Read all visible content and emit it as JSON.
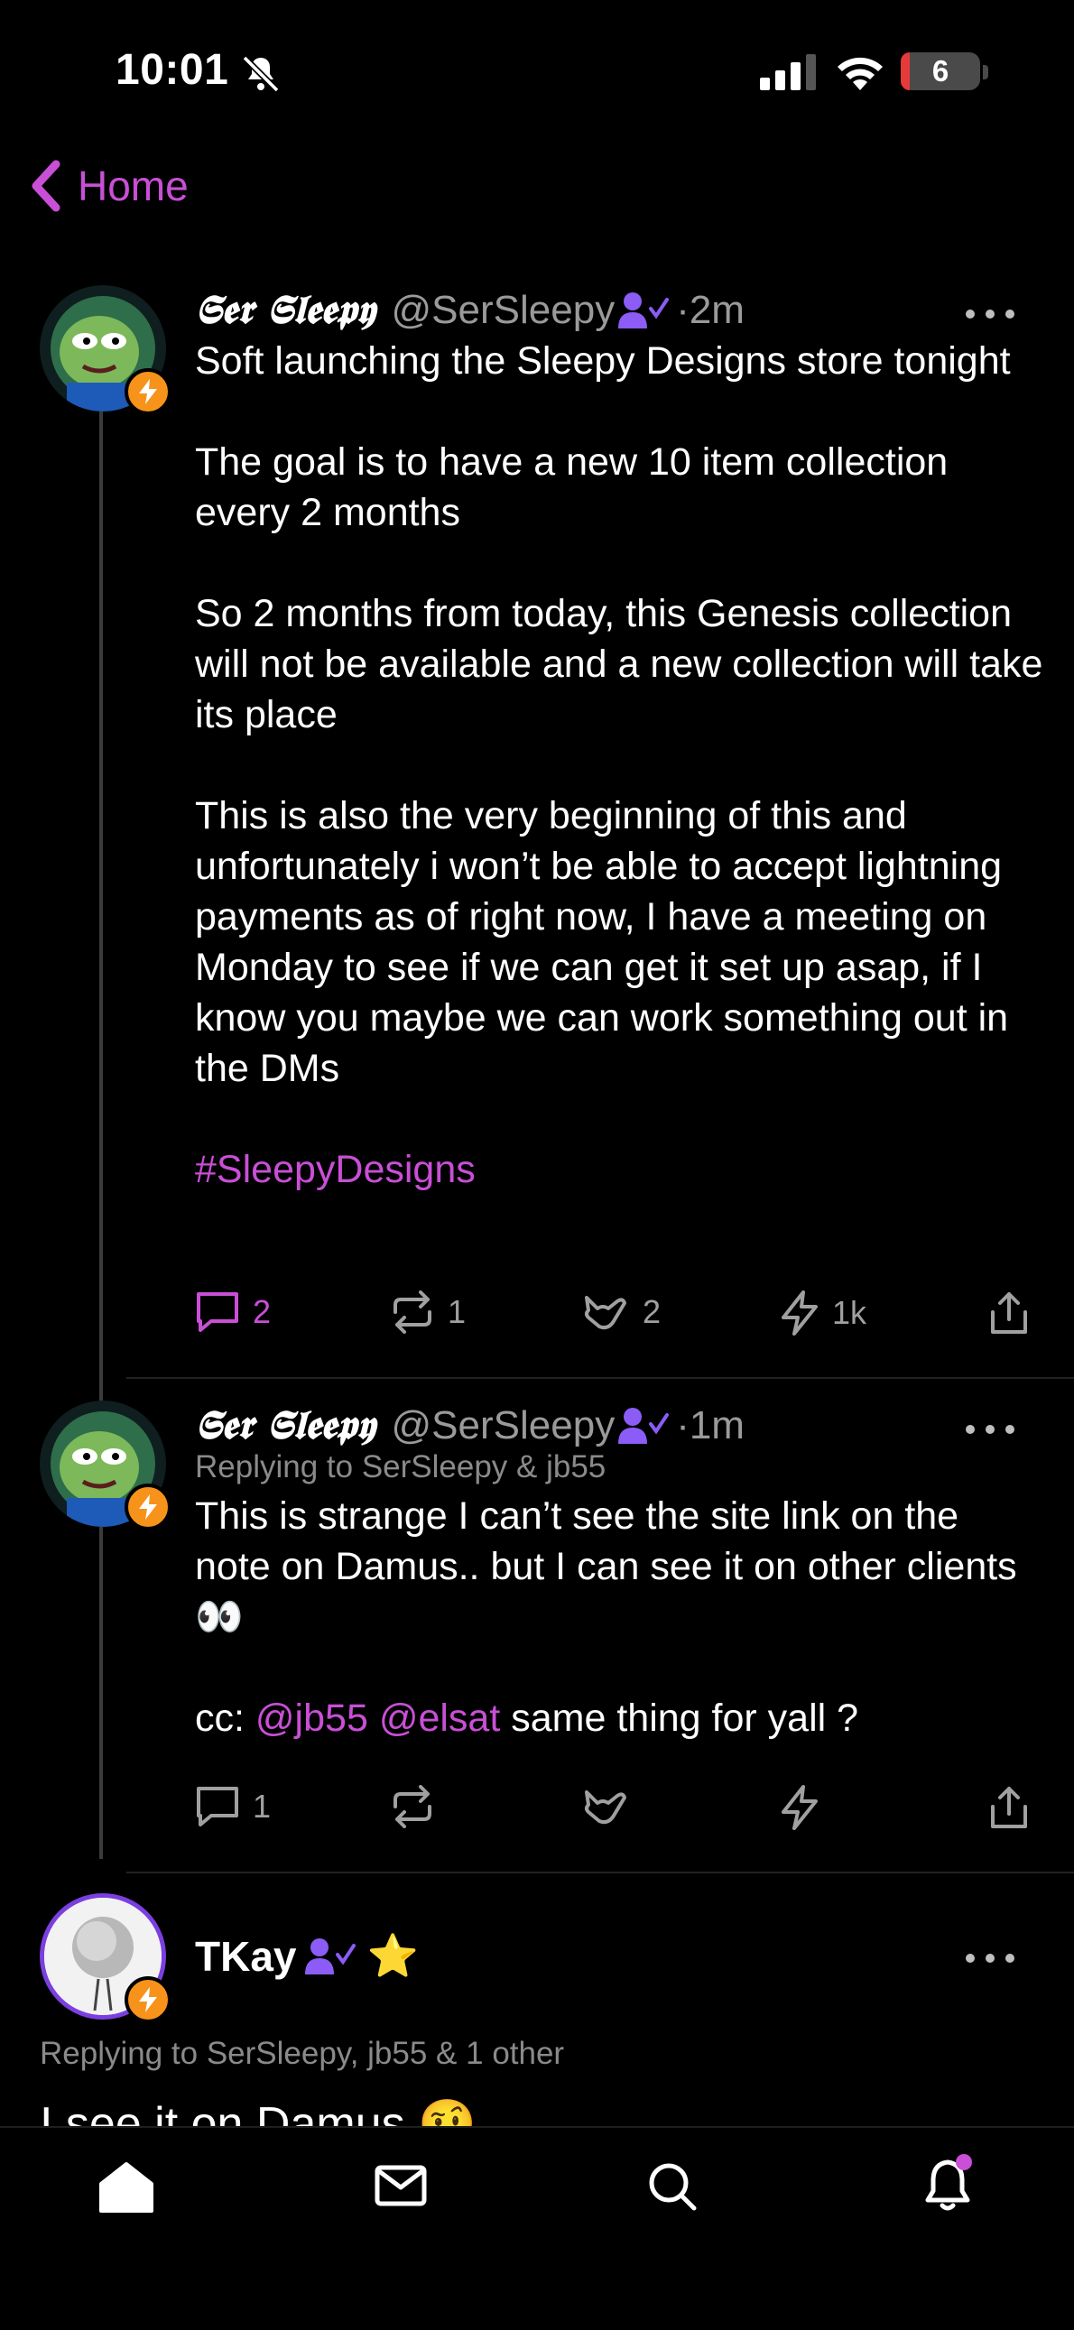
{
  "status_bar": {
    "time": "10:01",
    "battery": "6"
  },
  "header": {
    "back_label": "Home"
  },
  "posts": [
    {
      "display_name": "𝕾𝖊𝖗 𝕾𝖑𝖊𝖊𝖕𝖞",
      "handle": "@SerSleepy",
      "time": "·2m",
      "paragraphs": [
        "Soft launching the Sleepy Designs store tonight",
        "The goal is to have a new 10 item collection every 2 months",
        "So 2 months from today, this Genesis collection will not be available and a new collection will take its place",
        "This is also the very beginning of this and unfortunately i won’t be able to accept lightning payments as of right now, I have a meeting on Monday to see if we can get it set up asap, if I know you maybe we can work something out in the DMs"
      ],
      "hashtag": "#SleepyDesigns",
      "actions": {
        "replies": "2",
        "reposts": "1",
        "likes": "2",
        "zaps": "1k"
      }
    },
    {
      "display_name": "𝕾𝖊𝖗 𝕾𝖑𝖊𝖊𝖕𝖞",
      "handle": "@SerSleepy",
      "time": "·1m",
      "replying_to": "Replying to SerSleepy & jb55",
      "paragraph1": "This is strange I can’t see the site link on the note on Damus.. but I can see it on other clients 👀",
      "cc_prefix": "cc:",
      "mention1": "@jb55",
      "mention2": "@elsat",
      "cc_suffix": "same thing for yall ?",
      "actions": {
        "replies": "1"
      }
    },
    {
      "display_name": "TKay",
      "star": "⭐",
      "replying_to": "Replying to SerSleepy, jb55 & 1 other",
      "body": "I see it on Damus 🤨"
    }
  ],
  "colors": {
    "accent": "#c94fd6",
    "verified": "#8b5cf6",
    "zap": "#f7931a"
  },
  "tabs": [
    "home-icon",
    "mail-icon",
    "search-icon",
    "bell-icon"
  ]
}
